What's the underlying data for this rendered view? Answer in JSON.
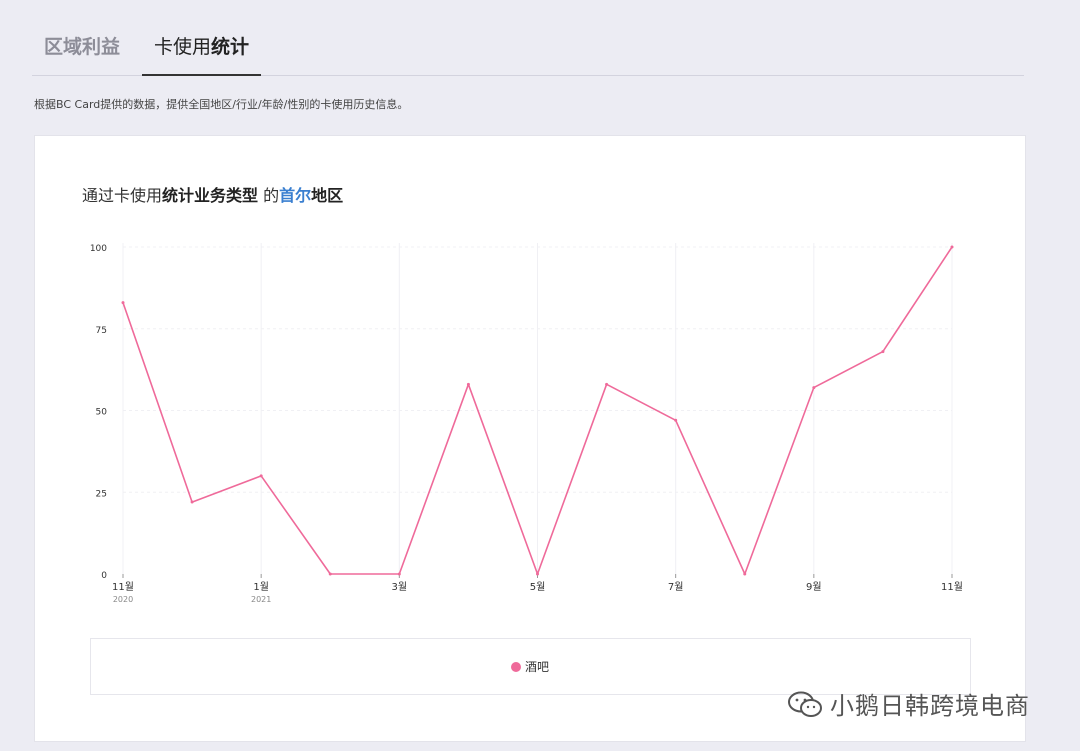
{
  "tabs": [
    {
      "label": "区域利益",
      "active": false
    },
    {
      "label_prefix": "卡使用",
      "label_bold": "统计",
      "active": true
    }
  ],
  "description": "根据BC Card提供的数据，提供全国地区/行业/年龄/性别的卡使用历史信息。",
  "card": {
    "title_prefix": "通过卡使用",
    "title_bold": "统计业务类型",
    "title_mid": " 的",
    "title_city": "首尔",
    "title_suffix": "地区"
  },
  "chart_data": {
    "type": "line",
    "x": [
      "2020-11",
      "2020-12",
      "2021-01",
      "2021-02",
      "2021-03",
      "2021-04",
      "2021-05",
      "2021-06",
      "2021-07",
      "2021-08",
      "2021-09",
      "2021-10",
      "2021-11"
    ],
    "x_tick_labels": [
      "11월",
      "",
      "1월",
      "",
      "3월",
      "",
      "5월",
      "",
      "7월",
      "",
      "9월",
      "",
      "11월"
    ],
    "x_year_labels": [
      "2020",
      "",
      "2021",
      "",
      "",
      "",
      "",
      "",
      "",
      "",
      "",
      "",
      ""
    ],
    "series": [
      {
        "name": "酒吧",
        "color": "#ef6a9a",
        "values": [
          83,
          22,
          30,
          0,
          0,
          58,
          0,
          58,
          47,
          0,
          57,
          68,
          100
        ]
      }
    ],
    "ylim": [
      0,
      100
    ],
    "y_ticks": [
      0,
      25,
      50,
      75,
      100
    ],
    "grid": true,
    "legend_position": "bottom"
  },
  "watermark": {
    "text": "小鹅日韩跨境电商",
    "icon": "wechat-icon"
  }
}
